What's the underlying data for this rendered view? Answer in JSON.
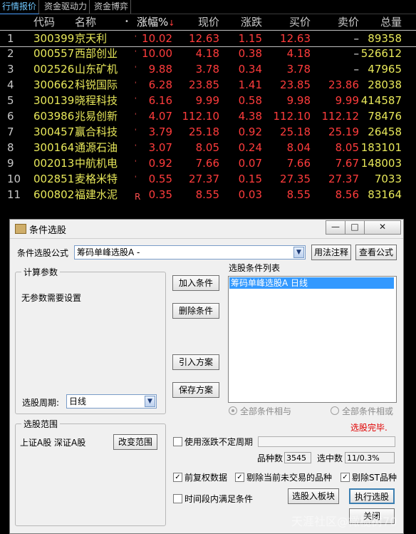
{
  "tabs": [
    "行情报价",
    "资金驱动力",
    "资金博弈"
  ],
  "header": {
    "code": "代码",
    "name": "名称",
    "dot": "•",
    "pct": "涨幅%",
    "pct_arrow": "↓",
    "price": "现价",
    "chg": "涨跌",
    "buy": "买价",
    "sell": "卖价",
    "vol": "总量"
  },
  "rows": [
    {
      "idx": "1",
      "code": "300399",
      "name": "京天利",
      "mark": "'",
      "pct": "10.02",
      "price": "12.63",
      "chg": "1.15",
      "buy": "12.63",
      "sell": "–",
      "vol": "89358"
    },
    {
      "idx": "2",
      "code": "000557",
      "name": "西部创业",
      "mark": "'",
      "pct": "10.00",
      "price": "4.18",
      "chg": "0.38",
      "buy": "4.18",
      "sell": "–",
      "vol": "526612"
    },
    {
      "idx": "3",
      "code": "002526",
      "name": "山东矿机",
      "mark": "'",
      "pct": "9.88",
      "price": "3.78",
      "chg": "0.34",
      "buy": "3.78",
      "sell": "–",
      "vol": "47965"
    },
    {
      "idx": "4",
      "code": "300662",
      "name": "科锐国际",
      "mark": "'",
      "pct": "6.28",
      "price": "23.85",
      "chg": "1.41",
      "buy": "23.85",
      "sell": "23.86",
      "vol": "28038"
    },
    {
      "idx": "5",
      "code": "300139",
      "name": "晓程科技",
      "mark": "'",
      "pct": "6.16",
      "price": "9.99",
      "chg": "0.58",
      "buy": "9.98",
      "sell": "9.99",
      "vol": "414587"
    },
    {
      "idx": "6",
      "code": "603986",
      "name": "兆易创新",
      "mark": "'",
      "pct": "4.07",
      "price": "112.10",
      "chg": "4.38",
      "buy": "112.10",
      "sell": "112.12",
      "vol": "78476"
    },
    {
      "idx": "7",
      "code": "300457",
      "name": "赢合科技",
      "mark": "'",
      "pct": "3.79",
      "price": "25.18",
      "chg": "0.92",
      "buy": "25.18",
      "sell": "25.19",
      "vol": "26458"
    },
    {
      "idx": "8",
      "code": "300164",
      "name": "通源石油",
      "mark": "'",
      "pct": "3.07",
      "price": "8.05",
      "chg": "0.24",
      "buy": "8.04",
      "sell": "8.05",
      "vol": "183101"
    },
    {
      "idx": "9",
      "code": "002013",
      "name": "中航机电",
      "mark": "'",
      "pct": "0.92",
      "price": "7.66",
      "chg": "0.07",
      "buy": "7.66",
      "sell": "7.67",
      "vol": "148003"
    },
    {
      "idx": "10",
      "code": "002851",
      "name": "麦格米特",
      "mark": "'",
      "pct": "0.55",
      "price": "27.37",
      "chg": "0.15",
      "buy": "27.35",
      "sell": "27.37",
      "vol": "7033"
    },
    {
      "idx": "11",
      "code": "600802",
      "name": "福建水泥",
      "mark": "R",
      "pct": "0.35",
      "price": "8.55",
      "chg": "0.03",
      "buy": "8.55",
      "sell": "8.56",
      "vol": "83164"
    }
  ],
  "dialog": {
    "title": "条件选股",
    "formula_label": "条件选股公式",
    "formula_value": "筹码单峰选股A -",
    "btn_usage": "用法注释",
    "btn_view": "查看公式",
    "params_group": "计算参数",
    "params_text": "无参数需要设置",
    "period_label": "选股周期:",
    "period_value": "日线",
    "range_group": "选股范围",
    "range_text": "上证A股  深证A股",
    "btn_change_range": "改变范围",
    "btn_add": "加入条件",
    "btn_delete": "删除条件",
    "btn_import": "引入方案",
    "btn_save": "保存方案",
    "list_label": "选股条件列表",
    "list_item": "筹码单峰选股A   日线",
    "radio_and": "全部条件相与",
    "radio_or": "全部条件相或",
    "done_text": "选股完毕.",
    "use_uncertain": "使用涨跌不定周期",
    "count_label": "品种数",
    "count_value": "3545",
    "selected_label": "选中数",
    "selected_value": "11/0.3%",
    "progress": 1.0,
    "chk_prerights": "前复权数据",
    "chk_exclude": "剔除当前未交易的品种",
    "chk_st": "剔除ST品种",
    "chk_period": "时间段内满足条件",
    "btn_to_block": "选股入板块",
    "btn_run": "执行选股",
    "btn_close": "关闭",
    "win_min": "—",
    "win_max": "□",
    "win_close": "✕",
    "combo_arrow": "▼",
    "check_mark": "✓"
  },
  "watermark": "天涯社区@橄榄树70",
  "colors": {
    "rise": "#ff3c3c",
    "code": "#e8e85a",
    "background": "#000000",
    "selection": "#3399ff",
    "done": "#e00000"
  }
}
